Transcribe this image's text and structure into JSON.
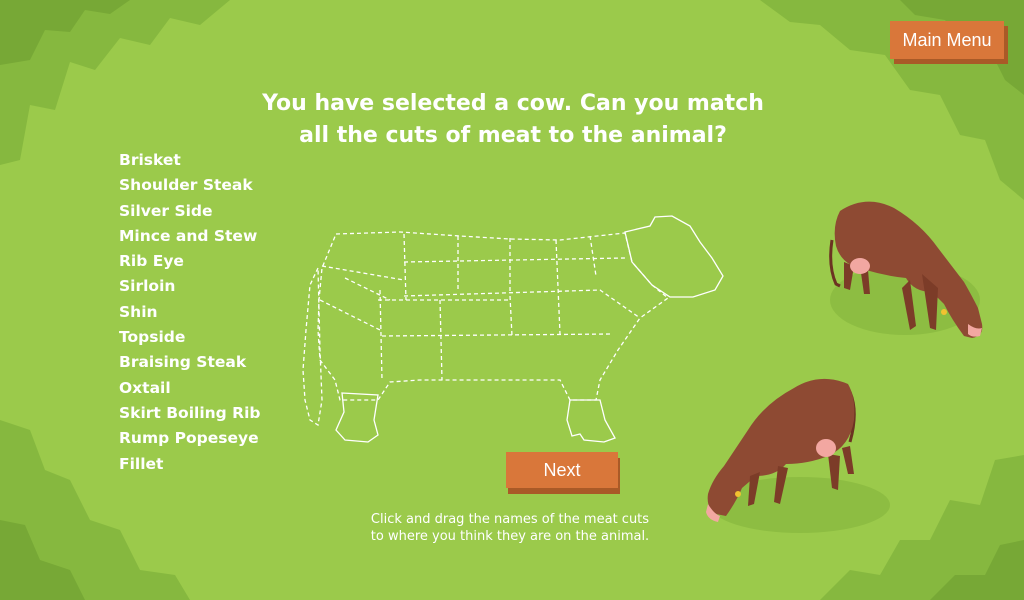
{
  "header": {
    "main_menu_label": "Main Menu",
    "title_line1": "You have selected a cow. Can you match",
    "title_line2": "all the cuts of meat to the animal?"
  },
  "meat_cuts": [
    "Brisket",
    "Shoulder Steak",
    "Silver Side",
    "Mince and Stew",
    "Rib Eye",
    "Sirloin",
    "Shin",
    "Topside",
    "Braising Steak",
    "Oxtail",
    "Skirt Boiling Rib",
    "Rump Popeseye",
    "Fillet"
  ],
  "controls": {
    "next_label": "Next"
  },
  "instructions": {
    "line1": "Click and drag the names of the meat cuts",
    "line2": "to where you think they are on the animal."
  },
  "colors": {
    "background": "#9bca4b",
    "foliage": "#7fb13a",
    "button": "#d9773a",
    "button_shadow": "#a95a27",
    "cow_body": "#8e4a33"
  }
}
